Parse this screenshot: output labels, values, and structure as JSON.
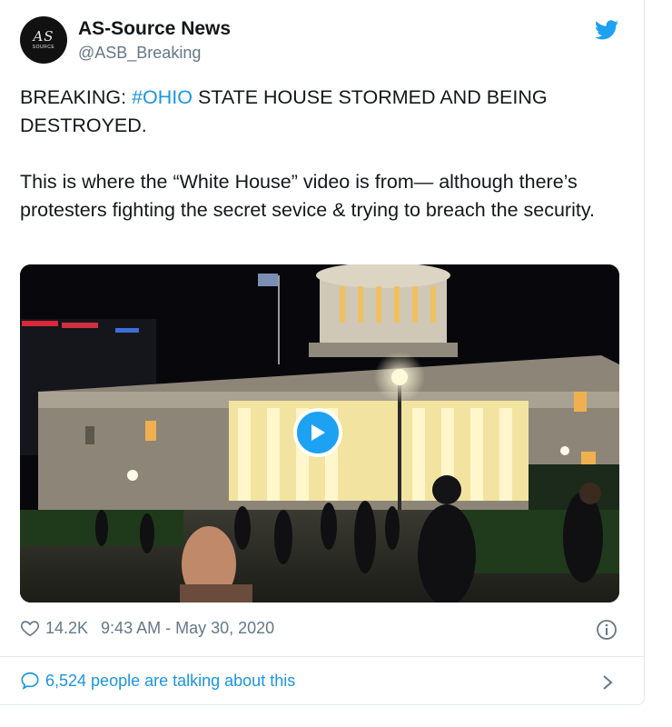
{
  "tweet": {
    "author_name": "AS-Source News",
    "author_handle": "@ASB_Breaking",
    "avatar_text": "AS",
    "avatar_subtext": "SOURCE",
    "text_prefix": "BREAKING: ",
    "hashtag": "#OHIO",
    "text_suffix": " STATE HOUSE STORMED AND BEING DESTROYED.",
    "text_paragraph2": "This is where the “White House” video is from— although there’s protesters fighting the secret sevice & trying to breach the security.",
    "likes": "14.2K",
    "timestamp": "9:43 AM - May 30, 2020",
    "talking": "6,524 people are talking about this"
  },
  "icons": {
    "brand": "twitter-bird-icon",
    "like": "heart-icon",
    "info": "info-icon",
    "reply": "speech-bubble-icon",
    "more": "chevron-right-icon",
    "media": "play-icon"
  },
  "colors": {
    "link": "#1b95e0",
    "twitter_blue": "#1da1f2",
    "secondary_text": "#657786"
  }
}
